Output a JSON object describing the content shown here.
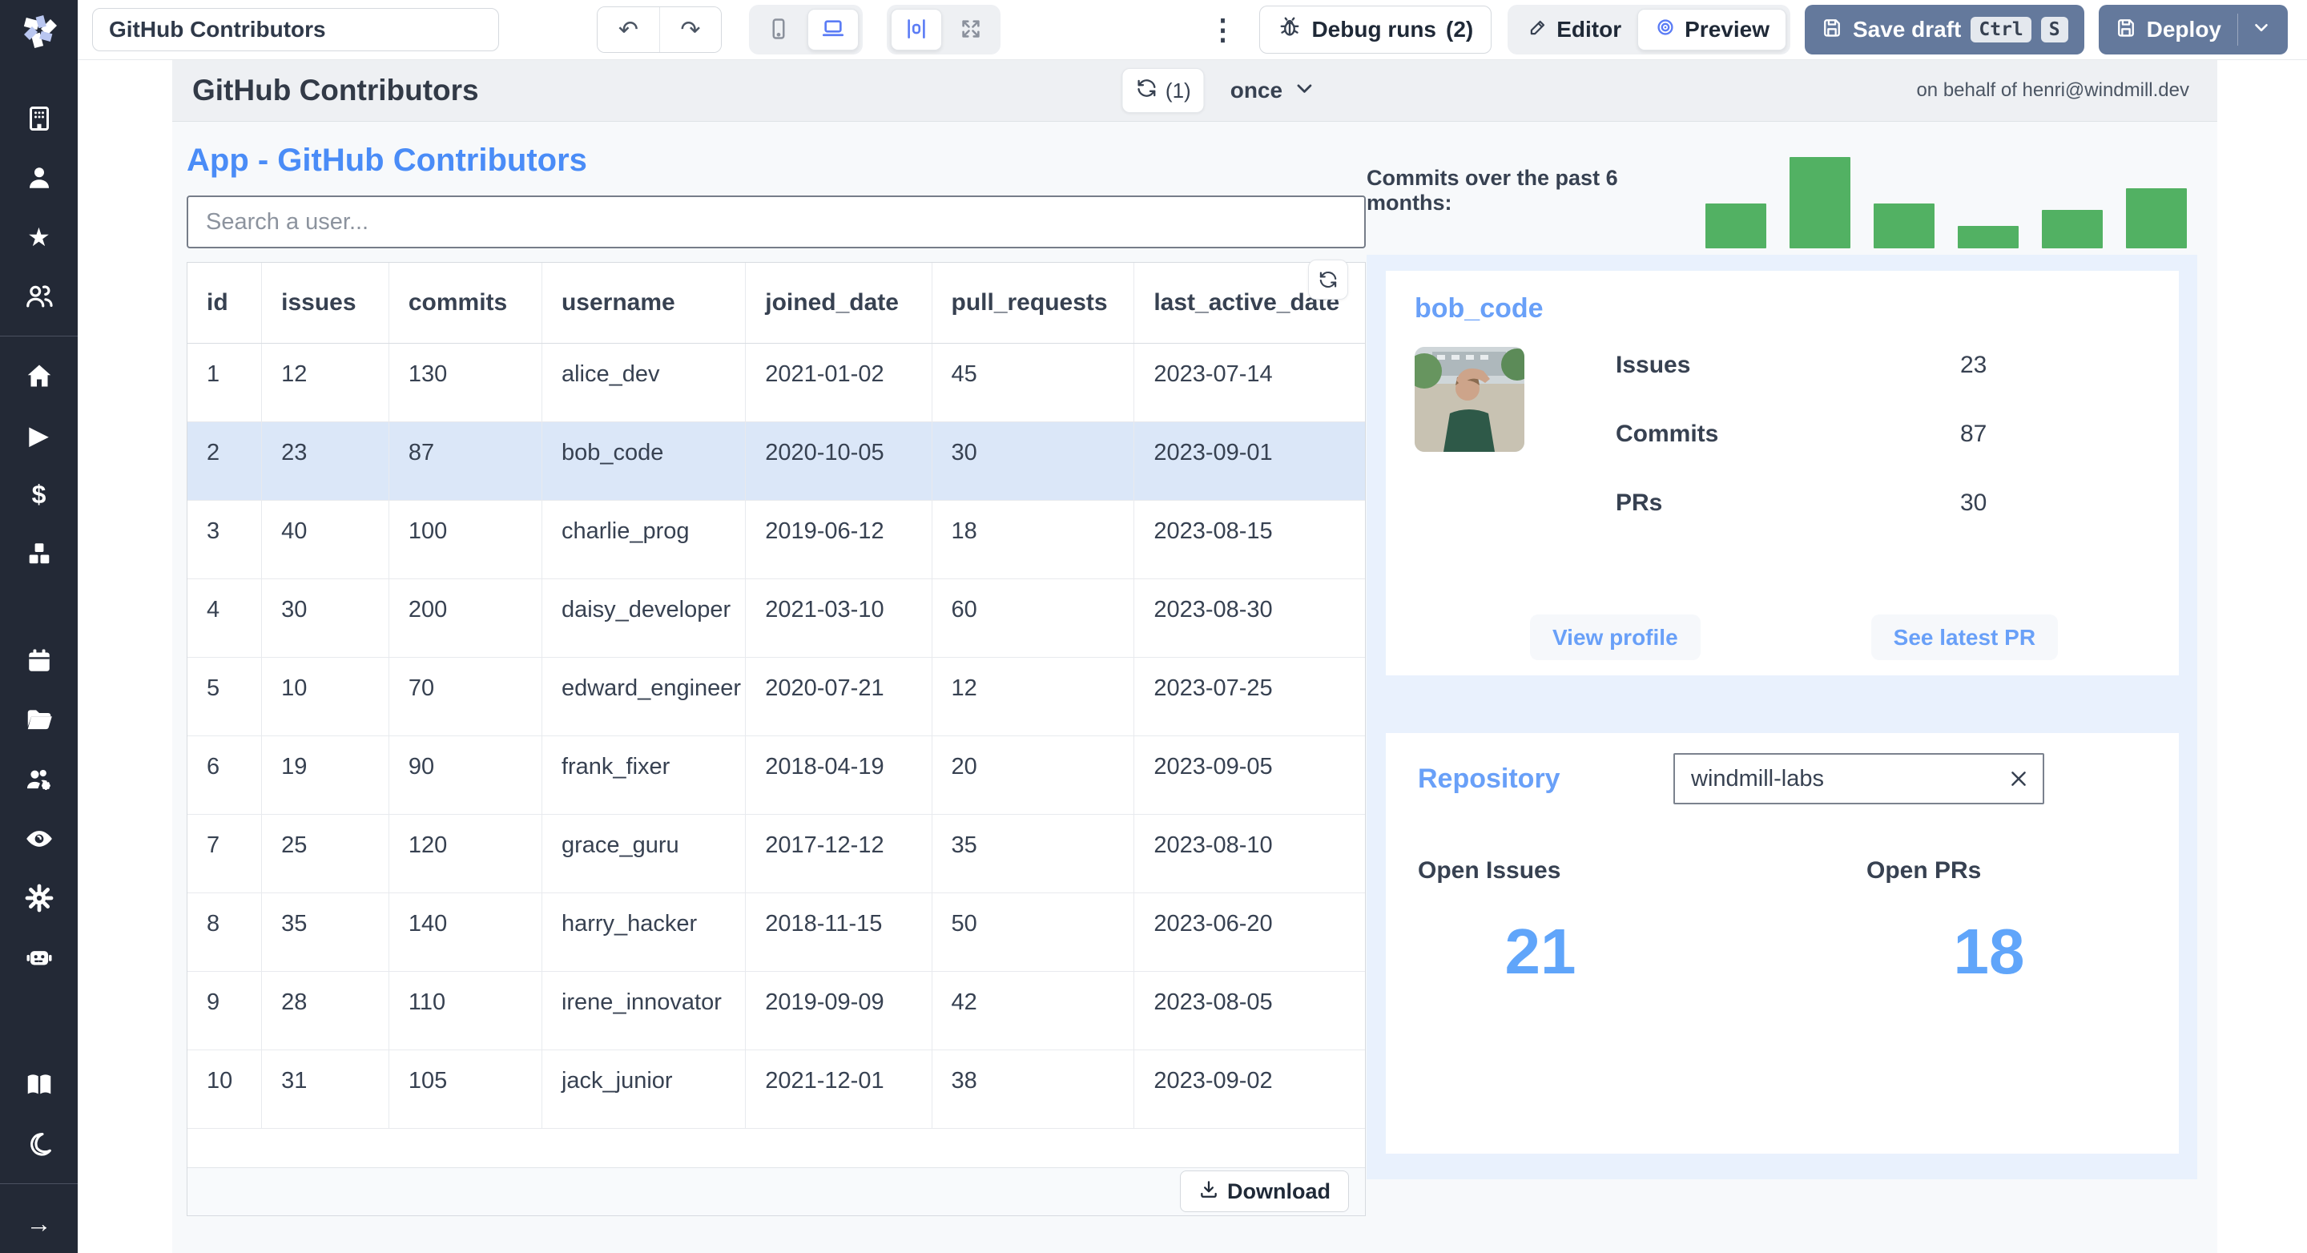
{
  "colors": {
    "sidebar_bg": "#232936",
    "accent_blue_link": "#4a8cf7",
    "card_heading_blue": "#69a0f8",
    "big_number_blue": "#60a5fa",
    "selected_icon_blue": "#5b7cf5",
    "bar_green": "#52b163",
    "primary_button_slate": "#64799c",
    "row_highlight": "#dbe7f8",
    "canvas_header": "#eef0f3",
    "panel_light_blue": "#e9f1fd"
  },
  "sidebar": {
    "icons": [
      "windmill-logo",
      "building",
      "user",
      "star",
      "users",
      "home",
      "play",
      "dollar",
      "cubes",
      "calendar",
      "folder",
      "users-gear",
      "eye",
      "gear",
      "robot",
      "book",
      "moon",
      "arrow-right"
    ]
  },
  "toolbar": {
    "app_name_value": "GitHub Contributors",
    "debug_runs_label": "Debug runs",
    "debug_runs_count": "(2)",
    "editor_label": "Editor",
    "preview_label": "Preview",
    "save_draft_label": "Save draft",
    "kbd_ctrl": "Ctrl",
    "kbd_s": "S",
    "deploy_label": "Deploy"
  },
  "app_header": {
    "title": "GitHub Contributors",
    "refresh_count": "(1)",
    "schedule": "once",
    "on_behalf_of": "on behalf of henri@windmill.dev"
  },
  "left": {
    "title": "App - GitHub Contributors",
    "search_placeholder": "Search a user...",
    "download_label": "Download"
  },
  "table": {
    "columns": [
      "id",
      "issues",
      "commits",
      "username",
      "joined_date",
      "pull_requests",
      "last_active_date"
    ],
    "highlighted_row_id": 2,
    "rows": [
      [
        1,
        12,
        130,
        "alice_dev",
        "2021-01-02",
        45,
        "2023-07-14"
      ],
      [
        2,
        23,
        87,
        "bob_code",
        "2020-10-05",
        30,
        "2023-09-01"
      ],
      [
        3,
        40,
        100,
        "charlie_prog",
        "2019-06-12",
        18,
        "2023-08-15"
      ],
      [
        4,
        30,
        200,
        "daisy_developer",
        "2021-03-10",
        60,
        "2023-08-30"
      ],
      [
        5,
        10,
        70,
        "edward_engineer",
        "2020-07-21",
        12,
        "2023-07-25"
      ],
      [
        6,
        19,
        90,
        "frank_fixer",
        "2018-04-19",
        20,
        "2023-09-05"
      ],
      [
        7,
        25,
        120,
        "grace_guru",
        "2017-12-12",
        35,
        "2023-08-10"
      ],
      [
        8,
        35,
        140,
        "harry_hacker",
        "2018-11-15",
        50,
        "2023-06-20"
      ],
      [
        9,
        28,
        110,
        "irene_innovator",
        "2019-09-09",
        42,
        "2023-08-05"
      ],
      [
        10,
        31,
        105,
        "jack_junior",
        "2021-12-01",
        38,
        "2023-09-02"
      ]
    ]
  },
  "chart_data": {
    "type": "bar",
    "title": "Commits over the past 6 months:",
    "values": [
      49,
      100,
      49,
      25,
      42,
      66
    ],
    "value_unit": "relative bar height percent (no axis labels shown)",
    "bar_color": "#52b163",
    "axes_visible": false,
    "legend": false
  },
  "user_card": {
    "username": "bob_code",
    "issues_label": "Issues",
    "issues_value": "23",
    "commits_label": "Commits",
    "commits_value": "87",
    "prs_label": "PRs",
    "prs_value": "30",
    "view_profile_label": "View profile",
    "see_latest_pr_label": "See latest PR"
  },
  "repo_card": {
    "title": "Repository",
    "repo_value": "windmill-labs",
    "open_issues_label": "Open Issues",
    "open_issues_value": "21",
    "open_prs_label": "Open PRs",
    "open_prs_value": "18"
  }
}
